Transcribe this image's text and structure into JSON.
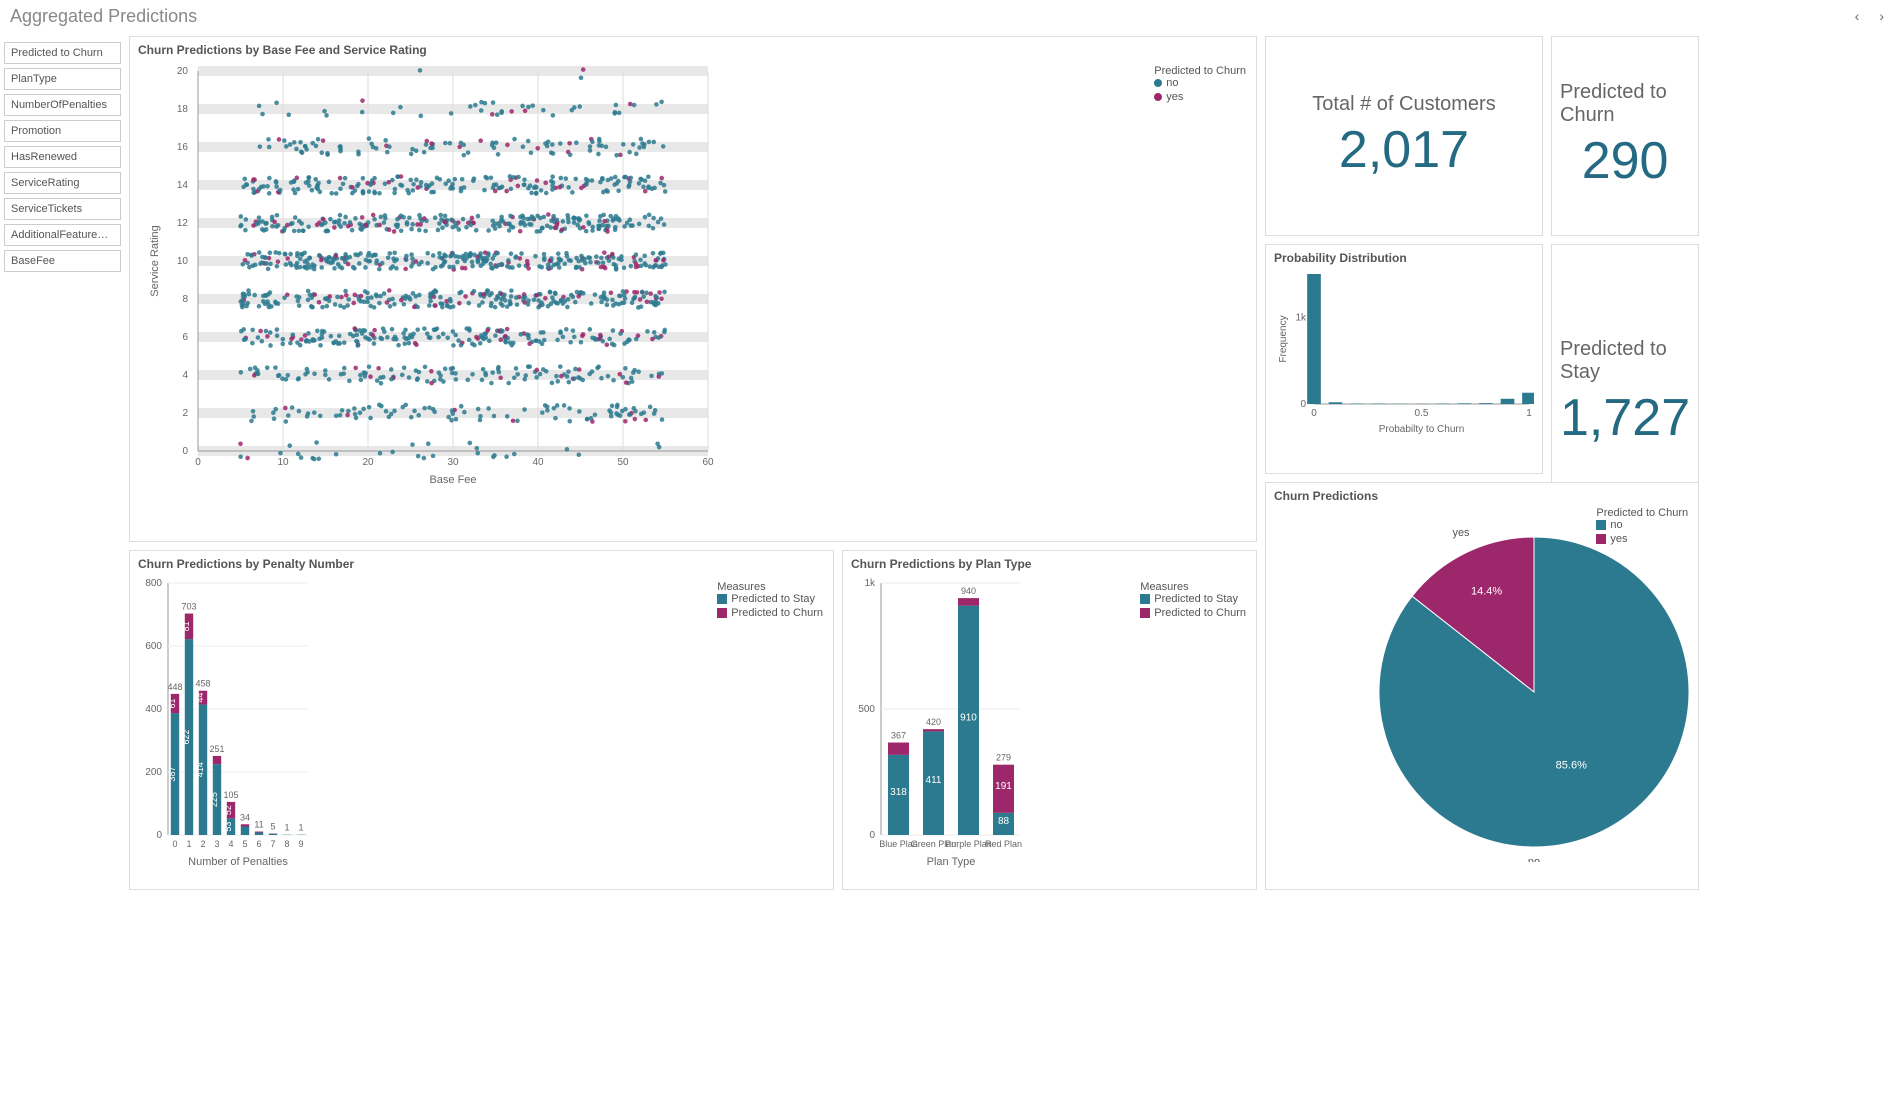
{
  "header": {
    "title": "Aggregated Predictions"
  },
  "sidebar": {
    "items": [
      "Predicted to Churn",
      "PlanType",
      "NumberOfPenalties",
      "Promotion",
      "HasRenewed",
      "ServiceRating",
      "ServiceTickets",
      "AdditionalFeatureSp...",
      "BaseFee"
    ]
  },
  "colors": {
    "stay": "#2c7a8f",
    "churn": "#9d276b"
  },
  "kpi": {
    "customers_label": "Total # of Customers",
    "customers": "2,017",
    "churn_label": "Predicted to Churn",
    "churn": "290",
    "stay_label": "Predicted to Stay",
    "stay": "1,727"
  },
  "legends": {
    "scatter_title": "Predicted to Churn",
    "no": "no",
    "yes": "yes",
    "measures_title": "Measures",
    "stay": "Predicted to Stay",
    "churn": "Predicted to Churn"
  },
  "chart_data": [
    {
      "id": "scatter",
      "type": "scatter",
      "title": "Churn Predictions by Base Fee and Service Rating",
      "xlabel": "Base Fee",
      "ylabel": "Service Rating",
      "xlim": [
        0,
        60
      ],
      "ylim": [
        0,
        20
      ],
      "xticks": [
        0,
        10,
        20,
        30,
        40,
        50,
        60
      ],
      "yticks": [
        0,
        2,
        4,
        6,
        8,
        10,
        12,
        14,
        16,
        18,
        20
      ],
      "note": "Dense scatter of ~2017 points; majority 'no' (teal), minority 'yes' (magenta); horizontal bands at even y-values 0–20."
    },
    {
      "id": "prob_dist",
      "type": "bar",
      "title": "Probability Distribution",
      "xlabel": "Probabilty to Churn",
      "ylabel": "Frequency",
      "xlim": [
        0,
        1
      ],
      "ylim": [
        0,
        1500
      ],
      "xticks": [
        0,
        0.5,
        1
      ],
      "yticks": [
        0,
        1000
      ],
      "categories": [
        0.0,
        0.1,
        0.2,
        0.3,
        0.4,
        0.5,
        0.6,
        0.7,
        0.8,
        0.9,
        1.0
      ],
      "values": [
        1500,
        20,
        5,
        5,
        3,
        3,
        5,
        8,
        10,
        60,
        130
      ]
    },
    {
      "id": "penalty",
      "type": "bar",
      "title": "Churn Predictions by Penalty Number",
      "xlabel": "Number of Penalties",
      "ylabel": "",
      "ylim": [
        0,
        800
      ],
      "yticks": [
        0,
        200,
        400,
        600,
        800
      ],
      "categories": [
        "0",
        "1",
        "2",
        "3",
        "4",
        "5",
        "6",
        "7",
        "8",
        "9"
      ],
      "series": [
        {
          "name": "Predicted to Stay",
          "values": [
            387,
            622,
            414,
            225,
            53,
            27,
            8,
            4,
            1,
            1
          ]
        },
        {
          "name": "Predicted to Churn",
          "values": [
            61,
            81,
            44,
            26,
            52,
            7,
            3,
            1,
            0,
            0
          ]
        }
      ],
      "totals": [
        448,
        703,
        458,
        251,
        105,
        34,
        11,
        5,
        1,
        1
      ]
    },
    {
      "id": "plan",
      "type": "bar",
      "title": "Churn Predictions by Plan Type",
      "xlabel": "Plan Type",
      "ylabel": "",
      "ylim": [
        0,
        1000
      ],
      "yticks": [
        0,
        500,
        1000
      ],
      "ytick_labels": [
        "0",
        "500",
        "1k"
      ],
      "categories": [
        "Blue Plan",
        "Green Plan",
        "Purple Plan",
        "Red Plan"
      ],
      "series": [
        {
          "name": "Predicted to Stay",
          "values": [
            318,
            411,
            910,
            88
          ]
        },
        {
          "name": "Predicted to Churn",
          "values": [
            49,
            9,
            30,
            191
          ]
        }
      ],
      "totals": [
        367,
        420,
        940,
        279
      ]
    },
    {
      "id": "pie",
      "type": "pie",
      "title": "Churn Predictions",
      "slices": [
        {
          "label": "no",
          "pct": 85.6,
          "value": 1727
        },
        {
          "label": "yes",
          "pct": 14.4,
          "value": 290
        }
      ]
    }
  ]
}
